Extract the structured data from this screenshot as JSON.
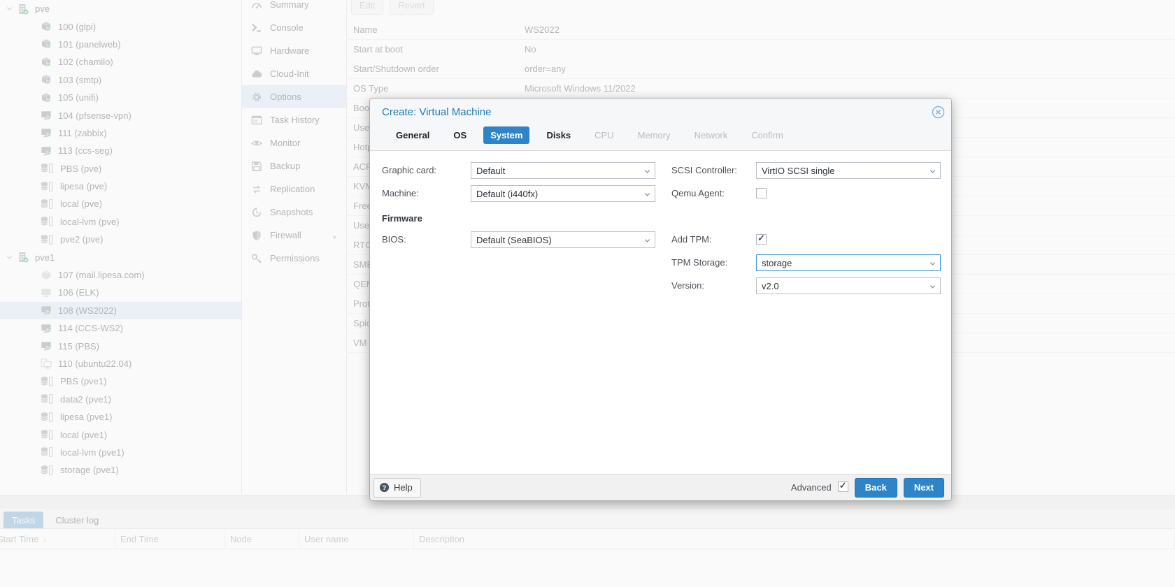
{
  "colors": {
    "accent_blue": "#2e84c8",
    "title_blue": "#1e7bb8",
    "selection_blue": "#d7e7f4",
    "running_green": "#52bd51",
    "node_check_green": "#27b84c"
  },
  "sidebar": {
    "tree": [
      {
        "label": "pve",
        "icon": "node",
        "level": 0,
        "expanded": true,
        "selected": false
      },
      {
        "label": "100 (glpi)",
        "icon": "ct-running",
        "level": 1,
        "selected": false
      },
      {
        "label": "101 (panelweb)",
        "icon": "ct-running",
        "level": 1,
        "selected": false
      },
      {
        "label": "102 (chamilo)",
        "icon": "ct-running",
        "level": 1,
        "selected": false
      },
      {
        "label": "103 (smtp)",
        "icon": "ct-running",
        "level": 1,
        "selected": false
      },
      {
        "label": "105 (unifi)",
        "icon": "ct-running",
        "level": 1,
        "selected": false
      },
      {
        "label": "104 (pfsense-vpn)",
        "icon": "vm-running",
        "level": 1,
        "selected": false
      },
      {
        "label": "111 (zabbix)",
        "icon": "vm-running",
        "level": 1,
        "selected": false
      },
      {
        "label": "113 (ccs-seg)",
        "icon": "vm-running",
        "level": 1,
        "selected": false
      },
      {
        "label": "PBS (pve)",
        "icon": "storage",
        "level": 1,
        "selected": false
      },
      {
        "label": "lipesa (pve)",
        "icon": "storage",
        "level": 1,
        "selected": false
      },
      {
        "label": "local (pve)",
        "icon": "storage",
        "level": 1,
        "selected": false
      },
      {
        "label": "local-lvm (pve)",
        "icon": "storage",
        "level": 1,
        "selected": false
      },
      {
        "label": "pve2 (pve)",
        "icon": "storage",
        "level": 1,
        "selected": false
      },
      {
        "label": "pve1",
        "icon": "node",
        "level": 0,
        "expanded": true,
        "selected": false
      },
      {
        "label": "107 (mail.lipesa.com)",
        "icon": "ct-stopped",
        "level": 1,
        "selected": false
      },
      {
        "label": "106 (ELK)",
        "icon": "vm-stopped",
        "level": 1,
        "selected": false
      },
      {
        "label": "108 (WS2022)",
        "icon": "vm-running",
        "level": 1,
        "selected": true
      },
      {
        "label": "114 (CCS-WS2)",
        "icon": "vm-running",
        "level": 1,
        "selected": false
      },
      {
        "label": "115 (PBS)",
        "icon": "vm-running",
        "level": 1,
        "selected": false
      },
      {
        "label": "110 (ubuntu22.04)",
        "icon": "vm-template",
        "level": 1,
        "selected": false
      },
      {
        "label": "PBS (pve1)",
        "icon": "storage",
        "level": 1,
        "selected": false
      },
      {
        "label": "data2 (pve1)",
        "icon": "storage",
        "level": 1,
        "selected": false
      },
      {
        "label": "lipesa (pve1)",
        "icon": "storage",
        "level": 1,
        "selected": false
      },
      {
        "label": "local (pve1)",
        "icon": "storage",
        "level": 1,
        "selected": false
      },
      {
        "label": "local-lvm (pve1)",
        "icon": "storage",
        "level": 1,
        "selected": false
      },
      {
        "label": "storage (pve1)",
        "icon": "storage",
        "level": 1,
        "selected": false
      }
    ]
  },
  "menu": {
    "items": [
      {
        "label": "Summary",
        "icon": "gauge",
        "selected": false,
        "submenu": false
      },
      {
        "label": "Console",
        "icon": "terminal",
        "selected": false,
        "submenu": false
      },
      {
        "label": "Hardware",
        "icon": "display",
        "selected": false,
        "submenu": false
      },
      {
        "label": "Cloud-Init",
        "icon": "cloud",
        "selected": false,
        "submenu": false
      },
      {
        "label": "Options",
        "icon": "gear",
        "selected": true,
        "submenu": false
      },
      {
        "label": "Task History",
        "icon": "list",
        "selected": false,
        "submenu": false
      },
      {
        "label": "Monitor",
        "icon": "eye",
        "selected": false,
        "submenu": false
      },
      {
        "label": "Backup",
        "icon": "floppy",
        "selected": false,
        "submenu": false
      },
      {
        "label": "Replication",
        "icon": "repeat",
        "selected": false,
        "submenu": false
      },
      {
        "label": "Snapshots",
        "icon": "history",
        "selected": false,
        "submenu": false
      },
      {
        "label": "Firewall",
        "icon": "shield",
        "selected": false,
        "submenu": true
      },
      {
        "label": "Permissions",
        "icon": "key",
        "selected": false,
        "submenu": false
      }
    ]
  },
  "options_panel": {
    "toolbar": {
      "edit_label": "Edit",
      "revert_label": "Revert"
    },
    "rows": [
      {
        "label": "Name",
        "value": "WS2022"
      },
      {
        "label": "Start at boot",
        "value": "No"
      },
      {
        "label": "Start/Shutdown order",
        "value": "order=any"
      },
      {
        "label": "OS Type",
        "value": "Microsoft Windows 11/2022"
      },
      {
        "label": "Boo",
        "value": ""
      },
      {
        "label": "Use",
        "value": ""
      },
      {
        "label": "Hotp",
        "value": ""
      },
      {
        "label": "ACP",
        "value": ""
      },
      {
        "label": "KVM",
        "value": ""
      },
      {
        "label": "Free",
        "value": ""
      },
      {
        "label": "Use",
        "value": ""
      },
      {
        "label": "RTC",
        "value": ""
      },
      {
        "label": "SMB",
        "value": ""
      },
      {
        "label": "QEM",
        "value": ""
      },
      {
        "label": "Prot",
        "value": ""
      },
      {
        "label": "Spic",
        "value": ""
      },
      {
        "label": "VM",
        "value": ""
      }
    ]
  },
  "dialog": {
    "title": "Create: Virtual Machine",
    "tabs": [
      {
        "label": "General",
        "state": "enabled"
      },
      {
        "label": "OS",
        "state": "enabled"
      },
      {
        "label": "System",
        "state": "active"
      },
      {
        "label": "Disks",
        "state": "enabled"
      },
      {
        "label": "CPU",
        "state": "disabled"
      },
      {
        "label": "Memory",
        "state": "disabled"
      },
      {
        "label": "Network",
        "state": "disabled"
      },
      {
        "label": "Confirm",
        "state": "disabled"
      }
    ],
    "fields": {
      "graphic_card": {
        "label": "Graphic card:",
        "value": "Default"
      },
      "machine": {
        "label": "Machine:",
        "value": "Default (i440fx)"
      },
      "firmware_heading": "Firmware",
      "bios": {
        "label": "BIOS:",
        "value": "Default (SeaBIOS)"
      },
      "scsi_controller": {
        "label": "SCSI Controller:",
        "value": "VirtIO SCSI single"
      },
      "qemu_agent": {
        "label": "Qemu Agent:",
        "checked": false
      },
      "add_tpm": {
        "label": "Add TPM:",
        "checked": true
      },
      "tpm_storage": {
        "label": "TPM Storage:",
        "value": "storage",
        "focused": true
      },
      "version": {
        "label": "Version:",
        "value": "v2.0"
      }
    },
    "footer": {
      "help_label": "Help",
      "advanced_label": "Advanced",
      "advanced_checked": true,
      "back_label": "Back",
      "next_label": "Next"
    }
  },
  "taskbar": {
    "tabs": [
      {
        "label": "Tasks",
        "active": true
      },
      {
        "label": "Cluster log",
        "active": false
      }
    ],
    "columns": [
      {
        "label": "Start Time",
        "sorted": "desc"
      },
      {
        "label": "End Time",
        "sorted": null
      },
      {
        "label": "Node",
        "sorted": null
      },
      {
        "label": "User name",
        "sorted": null
      },
      {
        "label": "Description",
        "sorted": null
      }
    ]
  }
}
